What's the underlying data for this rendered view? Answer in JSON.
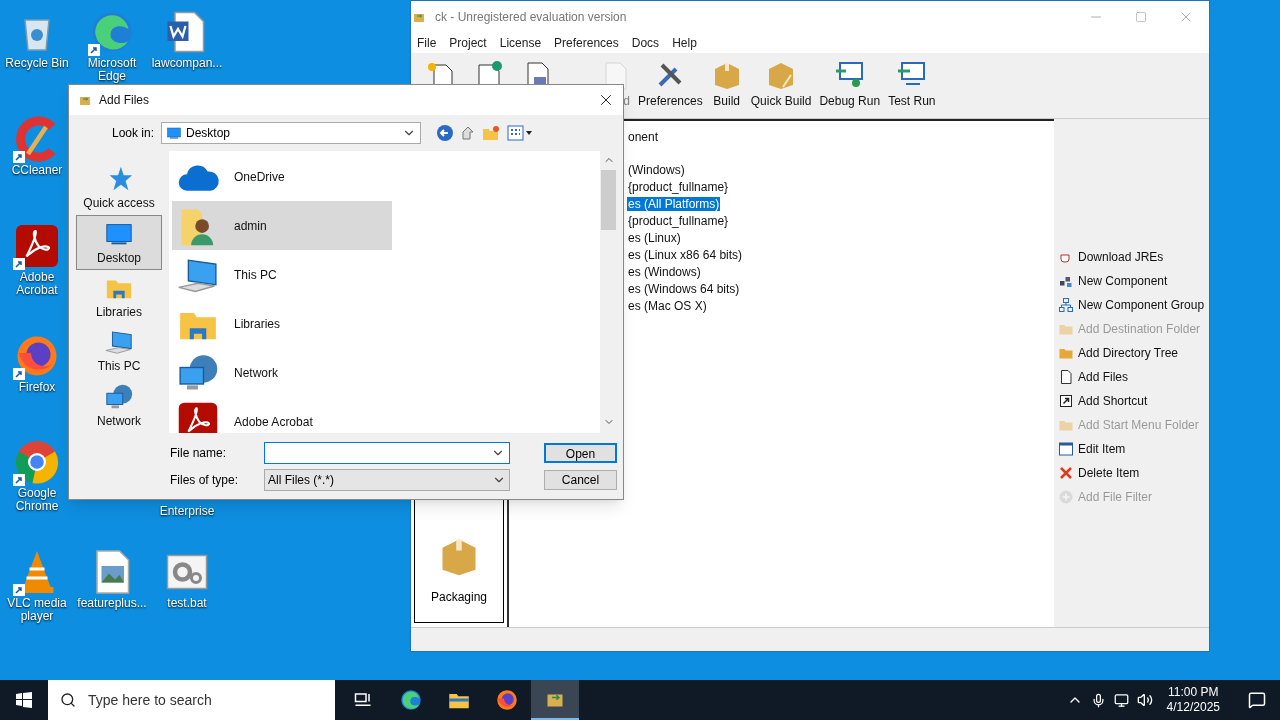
{
  "desktop": {
    "icons": [
      {
        "label": "Recycle Bin",
        "kind": "recycle",
        "shortcut": false
      },
      {
        "label": "Microsoft Edge",
        "kind": "edge",
        "shortcut": true
      },
      {
        "label": "lawcompan...",
        "kind": "word",
        "shortcut": false
      },
      {
        "label": "CCleaner",
        "kind": "ccleaner",
        "shortcut": true
      },
      {
        "label": "Adobe Acrobat",
        "kind": "acrobat",
        "shortcut": true
      },
      {
        "label": "Firefox",
        "kind": "firefox",
        "shortcut": true
      },
      {
        "label": "Google Chrome",
        "kind": "chrome",
        "shortcut": true
      },
      {
        "label": "VLC media player",
        "kind": "vlc",
        "shortcut": true
      },
      {
        "label": "featureplus...",
        "kind": "image",
        "shortcut": false
      },
      {
        "label": "test.bat",
        "kind": "bat",
        "shortcut": false
      }
    ],
    "partial_label": "Enterprise"
  },
  "main_window": {
    "title": "ck - Unregistered evaluation version",
    "menu": [
      "File",
      "Project",
      "License",
      "Preferences",
      "Docs",
      "Help"
    ],
    "toolbar": [
      {
        "kind": "new",
        "disabled": false
      },
      {
        "kind": "open",
        "disabled": false
      },
      {
        "kind": "save",
        "disabled": false
      },
      {
        "kind": "blank",
        "label": "d",
        "disabled": true
      },
      {
        "kind": "tools",
        "label": "Preferences",
        "disabled": false
      },
      {
        "kind": "box",
        "label": "Build",
        "disabled": false
      },
      {
        "kind": "box2",
        "label": "Quick Build",
        "disabled": false
      },
      {
        "kind": "debug",
        "label": "Debug Run",
        "disabled": false
      },
      {
        "kind": "run",
        "label": "Test Run",
        "disabled": false
      }
    ],
    "sidebar": {
      "items": [
        {
          "label": "Packaging",
          "kind": "box"
        }
      ]
    },
    "tree": {
      "rows": [
        {
          "label": "onent",
          "selected": false
        },
        {
          "label": "(Windows)",
          "selected": false
        },
        {
          "label": "{product_fullname}",
          "selected": false
        },
        {
          "label": "es (All Platforms)",
          "selected": true
        },
        {
          "label": "{product_fullname}",
          "selected": false
        },
        {
          "label": "es (Linux)",
          "selected": false
        },
        {
          "label": "es (Linux x86 64 bits)",
          "selected": false
        },
        {
          "label": "es (Windows)",
          "selected": false
        },
        {
          "label": "es (Windows 64 bits)",
          "selected": false
        },
        {
          "label": "es (Mac OS X)",
          "selected": false
        }
      ]
    },
    "actions": [
      {
        "label": "Download JREs",
        "kind": "cup",
        "disabled": false
      },
      {
        "label": "New Component",
        "kind": "component",
        "disabled": false
      },
      {
        "label": "New Component Group",
        "kind": "group",
        "disabled": false
      },
      {
        "label": "Add Destination Folder",
        "kind": "folder",
        "disabled": true
      },
      {
        "label": "Add Directory Tree",
        "kind": "folder",
        "disabled": false
      },
      {
        "label": "Add Files",
        "kind": "file",
        "disabled": false
      },
      {
        "label": "Add Shortcut",
        "kind": "shortcut",
        "disabled": false
      },
      {
        "label": "Add Start Menu Folder",
        "kind": "folder",
        "disabled": true
      },
      {
        "label": "Edit Item",
        "kind": "edit",
        "disabled": false
      },
      {
        "label": "Delete Item",
        "kind": "delete",
        "disabled": false
      },
      {
        "label": "Add File Filter",
        "kind": "add",
        "disabled": true
      }
    ]
  },
  "dialog": {
    "title": "Add Files",
    "look_in_label": "Look in:",
    "look_in": "Desktop",
    "places": [
      {
        "label": "Quick access",
        "kind": "star",
        "selected": false
      },
      {
        "label": "Desktop",
        "kind": "desktop",
        "selected": true
      },
      {
        "label": "Libraries",
        "kind": "libraries",
        "selected": false
      },
      {
        "label": "This PC",
        "kind": "pc",
        "selected": false
      },
      {
        "label": "Network",
        "kind": "network",
        "selected": false
      }
    ],
    "files": [
      {
        "label": "OneDrive",
        "kind": "cloud",
        "selected": false
      },
      {
        "label": "admin",
        "kind": "user",
        "selected": true
      },
      {
        "label": "This PC",
        "kind": "pc",
        "selected": false
      },
      {
        "label": "Libraries",
        "kind": "libraries",
        "selected": false
      },
      {
        "label": "Network",
        "kind": "network",
        "selected": false
      },
      {
        "label": "Adobe Acrobat",
        "kind": "acrobat",
        "selected": false
      }
    ],
    "file_name_label": "File name:",
    "file_type_label": "Files of type:",
    "file_type": "All Files (*.*)",
    "buttons": [
      "Open",
      "Cancel"
    ]
  },
  "taskbar": {
    "search_placeholder": "Type here to search",
    "apps": [
      {
        "kind": "taskview",
        "selected": false
      },
      {
        "kind": "edge",
        "selected": false
      },
      {
        "kind": "explorer",
        "selected": false
      },
      {
        "kind": "firefox",
        "selected": false
      },
      {
        "kind": "app",
        "selected": true
      }
    ],
    "time": "11:00 PM",
    "date": "4/12/2025"
  }
}
